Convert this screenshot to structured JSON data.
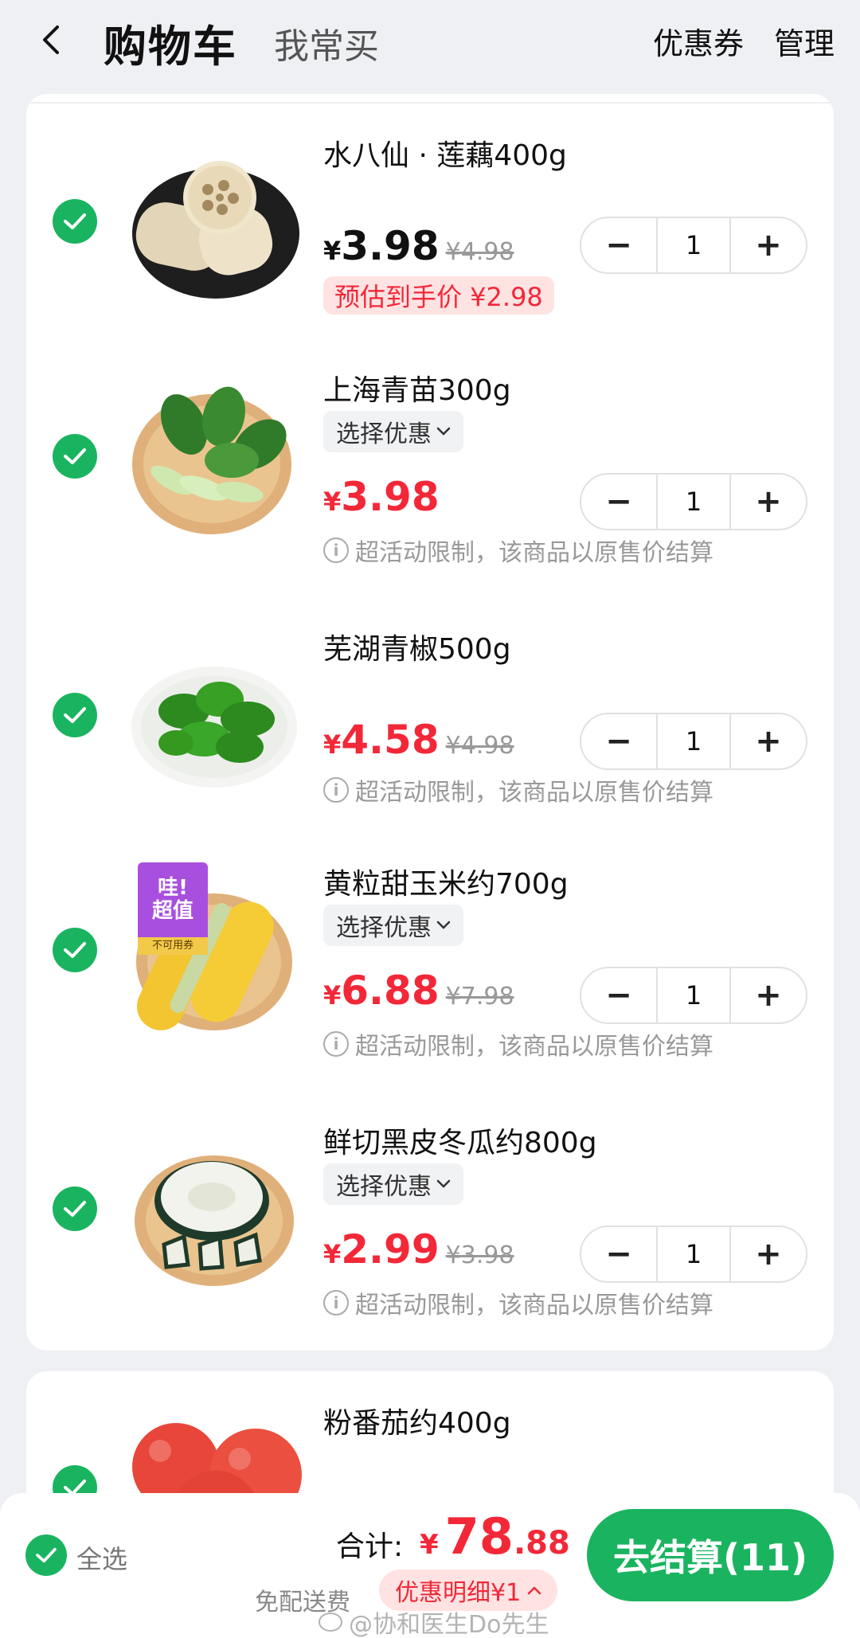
{
  "header": {
    "back_icon": "back-arrow-icon",
    "title": "购物车",
    "tab_frequent": "我常买",
    "coupon": "优惠券",
    "manage": "管理"
  },
  "colors": {
    "accent_green": "#1ab460",
    "price_red": "#f22838"
  },
  "items": [
    {
      "name": "水八仙 · 莲藕400g",
      "price_yen": "¥",
      "price": "3.98",
      "original_price": "¥4.98",
      "estimate": "预估到手价 ¥2.98",
      "quantity": "1",
      "checked": true,
      "image": "lotus-root"
    },
    {
      "name": "上海青苗300g",
      "promo": "选择优惠",
      "price_yen": "¥",
      "price": "3.98",
      "limit_note": "超活动限制，该商品以原售价结算",
      "quantity": "1",
      "checked": true,
      "image": "bok-choy"
    },
    {
      "name": "芜湖青椒500g",
      "price_yen": "¥",
      "price": "4.58",
      "original_price": "¥4.98",
      "limit_note": "超活动限制，该商品以原售价结算",
      "quantity": "1",
      "checked": true,
      "image": "green-pepper"
    },
    {
      "name": "黄粒甜玉米约700g",
      "promo": "选择优惠",
      "price_yen": "¥",
      "price": "6.88",
      "original_price": "¥7.98",
      "limit_note": "超活动限制，该商品以原售价结算",
      "quantity": "1",
      "checked": true,
      "image": "corn",
      "badge_line1": "哇!",
      "badge_line2": "超值",
      "badge_sub": "不可用券"
    },
    {
      "name": "鲜切黑皮冬瓜约800g",
      "promo": "选择优惠",
      "price_yen": "¥",
      "price": "2.99",
      "original_price": "¥3.98",
      "limit_note": "超活动限制，该商品以原售价结算",
      "quantity": "1",
      "checked": true,
      "image": "winter-melon"
    },
    {
      "name": "粉番茄约400g",
      "checked": true,
      "image": "tomato"
    }
  ],
  "bottom": {
    "select_all": "全选",
    "total_label": "合计:",
    "total_yen": "¥",
    "total_int": "78",
    "total_dec": ".88",
    "free_shipping": "免配送费",
    "discount_detail": "优惠明细¥1",
    "checkout": "去结算(11)",
    "watermark": "@协和医生Do先生"
  }
}
